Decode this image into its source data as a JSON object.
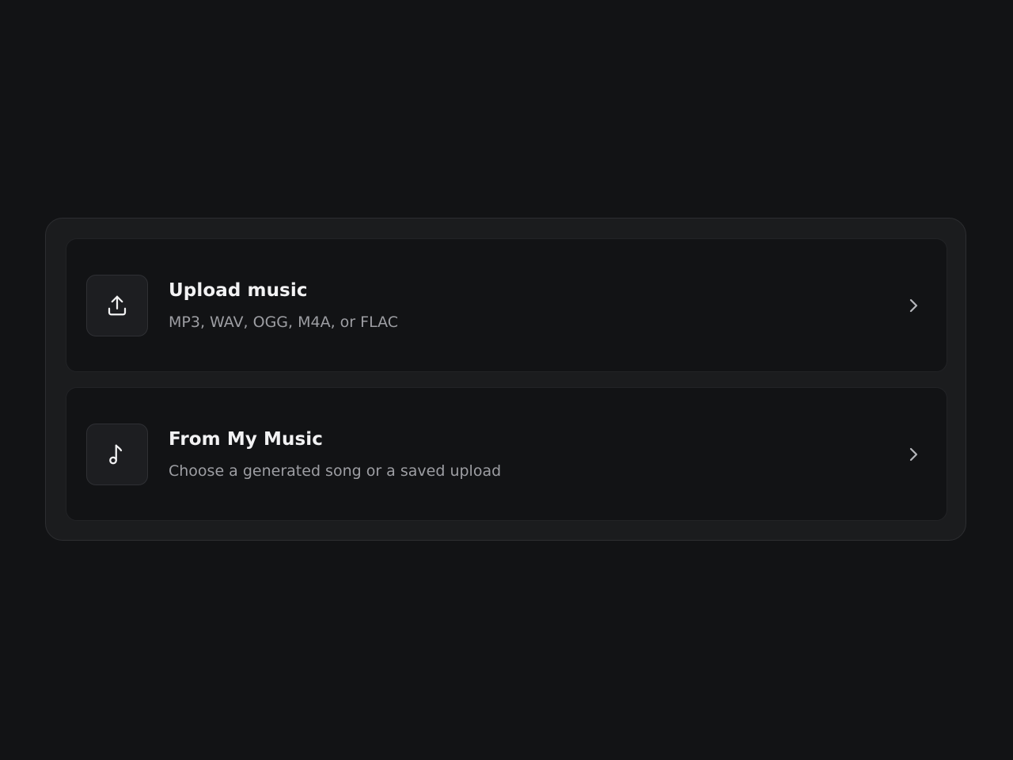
{
  "options": [
    {
      "title": "Upload music",
      "subtitle": "MP3, WAV, OGG, M4A, or FLAC",
      "icon": "upload-icon"
    },
    {
      "title": "From My Music",
      "subtitle": "Choose a generated song or a saved upload",
      "icon": "music-note-icon"
    }
  ],
  "colors": {
    "background": "#121315",
    "panel": "#1b1c1e",
    "text_primary": "#f2f2f3",
    "text_secondary": "#9d9ea3"
  }
}
